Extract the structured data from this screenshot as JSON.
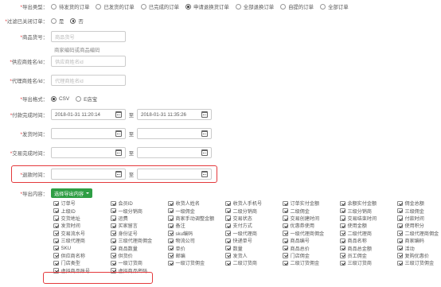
{
  "export_type": {
    "label": "*导出类型：",
    "options": [
      {
        "label": "待发货的订单",
        "selected": false
      },
      {
        "label": "已发货的订单",
        "selected": false
      },
      {
        "label": "已完成的订单",
        "selected": false
      },
      {
        "label": "申请退换货订单",
        "selected": true
      },
      {
        "label": "全部退换订单",
        "selected": false
      },
      {
        "label": "自提的订单",
        "selected": false
      },
      {
        "label": "全部订单",
        "selected": false
      }
    ]
  },
  "filter_closed": {
    "label": "*过滤已关闭订单：",
    "options": [
      {
        "label": "是",
        "selected": false
      },
      {
        "label": "否",
        "selected": true
      }
    ]
  },
  "product_code": {
    "label": "*商品货号：",
    "placeholder": "商品货号",
    "hint": "商家编码或商品编码"
  },
  "supplier": {
    "label": "*供应商姓名/id：",
    "placeholder": "供应商姓名id"
  },
  "agent": {
    "label": "*代理商姓名/id：",
    "placeholder": "代理商姓名id"
  },
  "export_format": {
    "label": "*导出格式：",
    "options": [
      {
        "label": "CSV",
        "selected": true
      },
      {
        "label": "E店宝",
        "selected": false
      }
    ]
  },
  "pay_time": {
    "label": "*付款完成时间：",
    "from": "2018-01-31 11:20:14",
    "to": "2018-01-31 11:35:26",
    "sep": "至"
  },
  "ship_time": {
    "label": "*发货时间：",
    "from": "",
    "to": "",
    "sep": "至"
  },
  "deal_time": {
    "label": "*交易完成时间：",
    "from": "",
    "to": "",
    "sep": "至"
  },
  "refund_time": {
    "label": "*退款时间：",
    "from": "",
    "to": "",
    "sep": "至"
  },
  "export_content": {
    "label": "*导出内容：",
    "select_button": "选择导出内容",
    "fields": [
      "订单号",
      "会员ID",
      "收货人姓名",
      "收货人手机号",
      "订单实付金额",
      "余额实付金额",
      "佣金总额",
      "上级ID",
      "一级分销商",
      "一级佣金",
      "二级分销商",
      "二级佣金",
      "三级分销商",
      "三级佣金",
      "交货地址",
      "运费",
      "商家手动调整金额",
      "交易状态",
      "交易创建时间",
      "交易结束时间",
      "付款时间",
      "发货时间",
      "买家留言",
      "备注",
      "支付方式",
      "优惠券使用",
      "使用金额",
      "使用积分",
      "交易流水号",
      "身份证号",
      "sku编码",
      "一级代理商",
      "一级代理商佣金",
      "二级代理商",
      "二级代理商佣金",
      "三级代理商",
      "三级代理商佣金",
      "物流公司",
      "快递单号",
      "商品编号",
      "商品名称",
      "商家编码",
      "SKU",
      "商品数量",
      "单价",
      "数量",
      "商品总价",
      "商品总金额",
      "活动",
      "供应商名称",
      "供货价",
      "邮编",
      "发货人",
      "门店佣金",
      "员工佣金",
      "复购优惠价",
      "门店类型",
      "一级订货商",
      "一级订货佣金",
      "二级订货商",
      "二级订货佣金",
      "三级订货商",
      "三级订货佣金",
      "虚拟商品账号",
      "虚拟商品密码"
    ]
  },
  "colors": {
    "highlight_border": "#e4393c",
    "button_green": "#2e9e44",
    "required_star": "#e4393c"
  }
}
